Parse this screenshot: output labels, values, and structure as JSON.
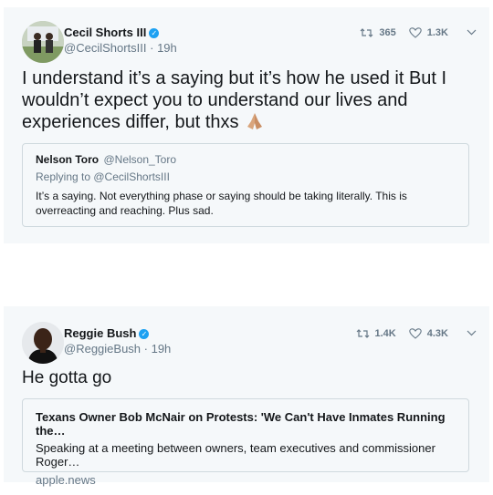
{
  "tweets": [
    {
      "author_name": "Cecil Shorts III",
      "author_handle": "@CecilShortsIII",
      "time": "19h",
      "retweets": "365",
      "likes": "1.3K",
      "text": "I understand it’s a saying but it’s how he used it But I wouldn’t expect you to understand our lives and experiences differ, but thxs",
      "quote": {
        "name": "Nelson Toro",
        "handle": "@Nelson_Toro",
        "replying_to": "Replying to @CecilShortsIII",
        "text": "It’s a saying. Not everything phase or saying should be taking literally. This is overreacting and reaching. Plus sad."
      }
    },
    {
      "author_name": "Reggie Bush",
      "author_handle": "@ReggieBush",
      "time": "19h",
      "retweets": "1.4K",
      "likes": "4.3K",
      "text": "He gotta go",
      "card": {
        "title": "Texans Owner Bob McNair on Protests: 'We Can't Have Inmates Running the…",
        "description": "Speaking at a meeting between owners, team executives and commissioner Roger…",
        "domain": "apple.news"
      }
    }
  ],
  "colors": {
    "background": "#f5f8fa",
    "text": "#14171a",
    "secondary": "#657786",
    "verified": "#1da1f2",
    "border": "#cfd9de"
  },
  "icons": [
    "retweet-icon",
    "heart-icon",
    "chevron-down-icon",
    "verified-badge-icon",
    "folded-hands-emoji"
  ]
}
